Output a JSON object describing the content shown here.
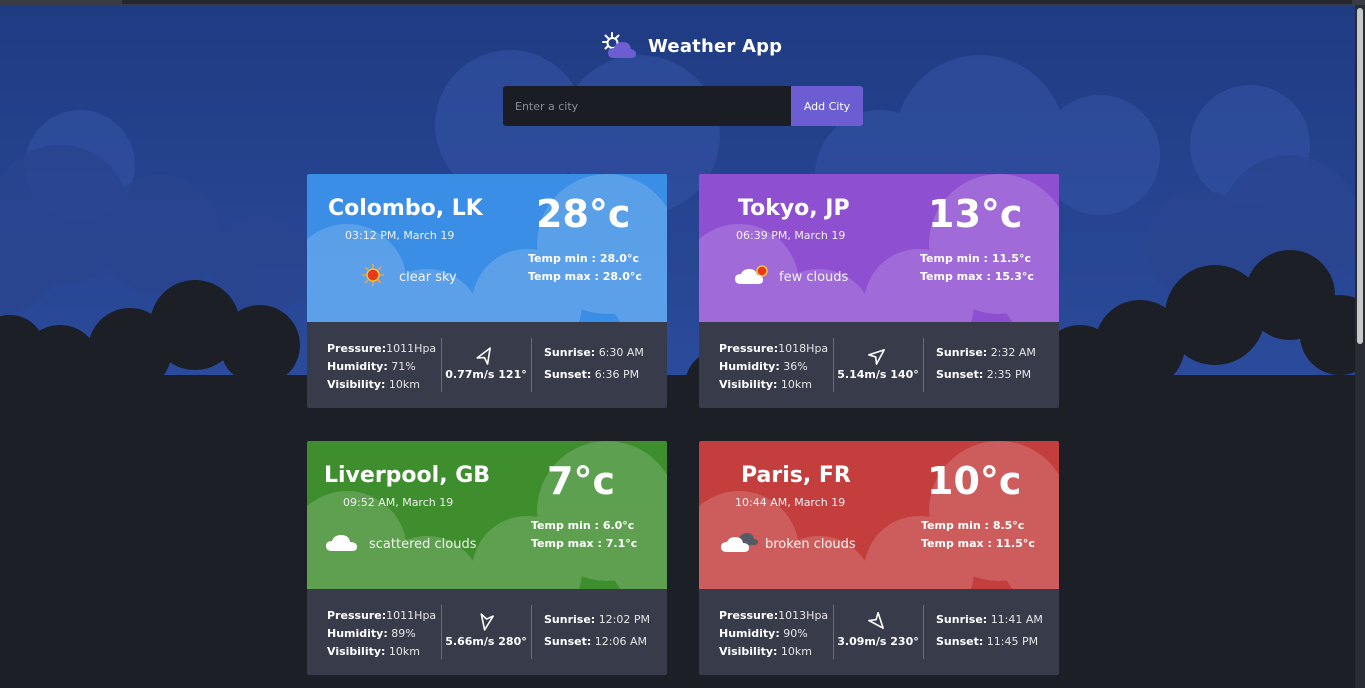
{
  "app": {
    "title": "Weather App"
  },
  "search": {
    "placeholder": "Enter a city",
    "value": "",
    "add_label": "Add City"
  },
  "labels": {
    "pressure": "Pressure:",
    "humidity": "Humidity:",
    "visibility": "Visibility:",
    "sunrise": "Sunrise:",
    "sunset": "Sunset:",
    "temp_min": "Temp min :",
    "temp_max": "Temp max :"
  },
  "cards": [
    {
      "city": "Colombo, LK",
      "datetime": "03:12 PM, March 19",
      "temp": "28°c",
      "temp_min": "28.0°c",
      "temp_max": "28.0°c",
      "condition": "clear sky",
      "icon": "sun-icon",
      "pressure": "1011Hpa",
      "humidity": "71%",
      "visibility": "10km",
      "wind": "0.77m/s 121°",
      "wind_deg": 121,
      "sunrise": "6:30 AM",
      "sunset": "6:36 PM",
      "color": "#3b8ee5"
    },
    {
      "city": "Tokyo, JP",
      "datetime": "06:39 PM, March 19",
      "temp": "13°c",
      "temp_min": "11.5°c",
      "temp_max": "15.3°c",
      "condition": "few clouds",
      "icon": "few-clouds-icon",
      "pressure": "1018Hpa",
      "humidity": "36%",
      "visibility": "10km",
      "wind": "5.14m/s 140°",
      "wind_deg": 140,
      "sunrise": "2:32 AM",
      "sunset": "2:35 PM",
      "color": "#8e4fd1"
    },
    {
      "city": "Liverpool, GB",
      "datetime": "09:52 AM, March 19",
      "temp": "7°c",
      "temp_min": "6.0°c",
      "temp_max": "7.1°c",
      "condition": "scattered clouds",
      "icon": "cloud-icon",
      "pressure": "1011Hpa",
      "humidity": "89%",
      "visibility": "10km",
      "wind": "5.66m/s 280°",
      "wind_deg": 280,
      "sunrise": "12:02 PM",
      "sunset": "12:06 AM",
      "color": "#3f8e2e"
    },
    {
      "city": "Paris, FR",
      "datetime": "10:44 AM, March 19",
      "temp": "10°c",
      "temp_min": "8.5°c",
      "temp_max": "11.5°c",
      "condition": "broken clouds",
      "icon": "broken-clouds-icon",
      "pressure": "1013Hpa",
      "humidity": "90%",
      "visibility": "10km",
      "wind": "3.09m/s 230°",
      "wind_deg": 230,
      "sunrise": "11:41 AM",
      "sunset": "11:45 PM",
      "color": "#c43e3e"
    }
  ],
  "colors": {
    "sky_top": "#1f3b82",
    "sky_bottom": "#2d4fa0",
    "ground": "#1d1f27",
    "accent": "#6c5dd3"
  }
}
